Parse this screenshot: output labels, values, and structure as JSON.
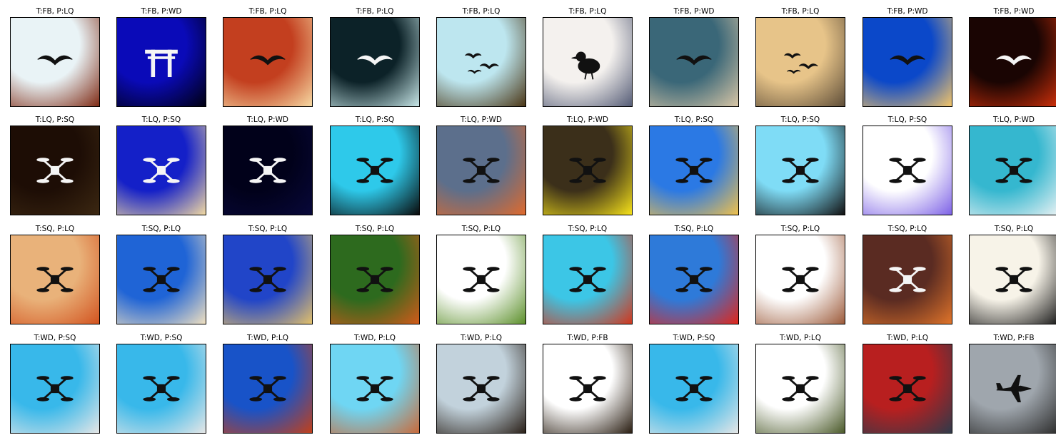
{
  "figure": {
    "rows": [
      {
        "true_label": "FB",
        "cells": [
          {
            "title": "T:FB, P:LQ",
            "subject_icon": "bird-icon",
            "colors": [
              "#e9f3f6",
              "#7f2a14"
            ]
          },
          {
            "title": "T:FB, P:WD",
            "subject_icon": "torii-gate-icon",
            "colors": [
              "#0a0ab8",
              "#000010"
            ]
          },
          {
            "title": "T:FB, P:LQ",
            "subject_icon": "bird-icon",
            "colors": [
              "#c33f1f",
              "#f6d9a3"
            ]
          },
          {
            "title": "T:FB, P:LQ",
            "subject_icon": "bird-icon",
            "colors": [
              "#0c2228",
              "#c8e7e8"
            ]
          },
          {
            "title": "T:FB, P:LQ",
            "subject_icon": "bird-flock-icon",
            "colors": [
              "#bde6ef",
              "#4a3514"
            ]
          },
          {
            "title": "T:FB, P:LQ",
            "subject_icon": "pigeon-icon",
            "colors": [
              "#f4f1ee",
              "#555c76"
            ]
          },
          {
            "title": "T:FB, P:WD",
            "subject_icon": "bird-icon",
            "colors": [
              "#3a6778",
              "#d9c6a6"
            ]
          },
          {
            "title": "T:FB, P:LQ",
            "subject_icon": "bird-flock-icon",
            "colors": [
              "#e7c489",
              "#5e4d38"
            ]
          },
          {
            "title": "T:FB, P:WD",
            "subject_icon": "bird-icon",
            "colors": [
              "#0b48c9",
              "#f3c568"
            ]
          },
          {
            "title": "T:FB, P:WD",
            "subject_icon": "bird-icon",
            "colors": [
              "#1a0503",
              "#d0300a"
            ]
          }
        ]
      },
      {
        "true_label": "LQ",
        "cells": [
          {
            "title": "T:LQ, P:SQ",
            "subject_icon": "drone-icon",
            "colors": [
              "#1d0d05",
              "#3c2812"
            ]
          },
          {
            "title": "T:LQ, P:SQ",
            "subject_icon": "drone-icon",
            "colors": [
              "#1420c8",
              "#f1d9a2"
            ]
          },
          {
            "title": "T:LQ, P:WD",
            "subject_icon": "drone-icon",
            "colors": [
              "#01011a",
              "#08083a"
            ]
          },
          {
            "title": "T:LQ, P:SQ",
            "subject_icon": "drone-icon",
            "colors": [
              "#2ec9ea",
              "#0a0a0a"
            ]
          },
          {
            "title": "T:LQ, P:WD",
            "subject_icon": "drone-icon",
            "colors": [
              "#5c6f8c",
              "#e06a2c"
            ]
          },
          {
            "title": "T:LQ, P:WD",
            "subject_icon": "drone-icon",
            "colors": [
              "#3b2f1a",
              "#f6e21a"
            ]
          },
          {
            "title": "T:LQ, P:SQ",
            "subject_icon": "drone-icon",
            "colors": [
              "#2b79e4",
              "#f0c14b"
            ]
          },
          {
            "title": "T:LQ, P:SQ",
            "subject_icon": "drone-icon",
            "colors": [
              "#7fdcf6",
              "#111111"
            ]
          },
          {
            "title": "T:LQ, P:SQ",
            "subject_icon": "drone-icon",
            "colors": [
              "#ffffff",
              "#7d62e6"
            ]
          },
          {
            "title": "T:LQ, P:WD",
            "subject_icon": "drone-icon",
            "colors": [
              "#35b7cf",
              "#e8f1f3"
            ]
          }
        ]
      },
      {
        "true_label": "SQ",
        "cells": [
          {
            "title": "T:SQ, P:LQ",
            "subject_icon": "drone-icon",
            "colors": [
              "#e9b27a",
              "#d2531f"
            ]
          },
          {
            "title": "T:SQ, P:LQ",
            "subject_icon": "drone-icon",
            "colors": [
              "#1f64d6",
              "#f0e0c0"
            ]
          },
          {
            "title": "T:SQ, P:LQ",
            "subject_icon": "drone-icon",
            "colors": [
              "#2145c8",
              "#e2c06a"
            ]
          },
          {
            "title": "T:SQ, P:LQ",
            "subject_icon": "drone-icon",
            "colors": [
              "#2d6a1e",
              "#d25a1a"
            ]
          },
          {
            "title": "T:SQ, P:LQ",
            "subject_icon": "drone-icon",
            "colors": [
              "#ffffff",
              "#5b8f2a"
            ]
          },
          {
            "title": "T:SQ, P:LQ",
            "subject_icon": "drone-icon",
            "colors": [
              "#3cc6e6",
              "#d2361c"
            ]
          },
          {
            "title": "T:SQ, P:LQ",
            "subject_icon": "drone-icon",
            "colors": [
              "#2e7ad9",
              "#e1261a"
            ]
          },
          {
            "title": "T:SQ, P:LQ",
            "subject_icon": "drone-icon",
            "colors": [
              "#ffffff",
              "#9c5a3a"
            ]
          },
          {
            "title": "T:SQ, P:LQ",
            "subject_icon": "drone-icon",
            "colors": [
              "#5a2b22",
              "#e0742a"
            ]
          },
          {
            "title": "T:SQ, P:LQ",
            "subject_icon": "drone-icon",
            "colors": [
              "#f7f3e8",
              "#1a1a1a"
            ]
          }
        ]
      },
      {
        "true_label": "WD",
        "cells": [
          {
            "title": "T:WD, P:SQ",
            "subject_icon": "drone-icon",
            "colors": [
              "#38b8ea",
              "#e6e6e6"
            ]
          },
          {
            "title": "T:WD, P:SQ",
            "subject_icon": "drone-icon",
            "colors": [
              "#38b8ea",
              "#e6e6e6"
            ]
          },
          {
            "title": "T:WD, P:LQ",
            "subject_icon": "drone-icon",
            "colors": [
              "#1853c8",
              "#c2401a"
            ]
          },
          {
            "title": "T:WD, P:LQ",
            "subject_icon": "drone-icon",
            "colors": [
              "#6fd6f3",
              "#c96a3a"
            ]
          },
          {
            "title": "T:WD, P:LQ",
            "subject_icon": "drone-icon",
            "colors": [
              "#c2d2dc",
              "#2a2018"
            ]
          },
          {
            "title": "T:WD, P:FB",
            "subject_icon": "drone-icon",
            "colors": [
              "#ffffff",
              "#2a1e12"
            ]
          },
          {
            "title": "T:WD, P:SQ",
            "subject_icon": "drone-icon",
            "colors": [
              "#38b8ea",
              "#e6e6e6"
            ]
          },
          {
            "title": "T:WD, P:LQ",
            "subject_icon": "drone-icon",
            "colors": [
              "#ffffff",
              "#4b5a2a"
            ]
          },
          {
            "title": "T:WD, P:LQ",
            "subject_icon": "drone-icon",
            "colors": [
              "#b81f1f",
              "#2f3a4a"
            ]
          },
          {
            "title": "T:WD, P:FB",
            "subject_icon": "aircraft-icon",
            "colors": [
              "#9fa6ad",
              "#2c2c2c"
            ]
          }
        ]
      }
    ]
  }
}
